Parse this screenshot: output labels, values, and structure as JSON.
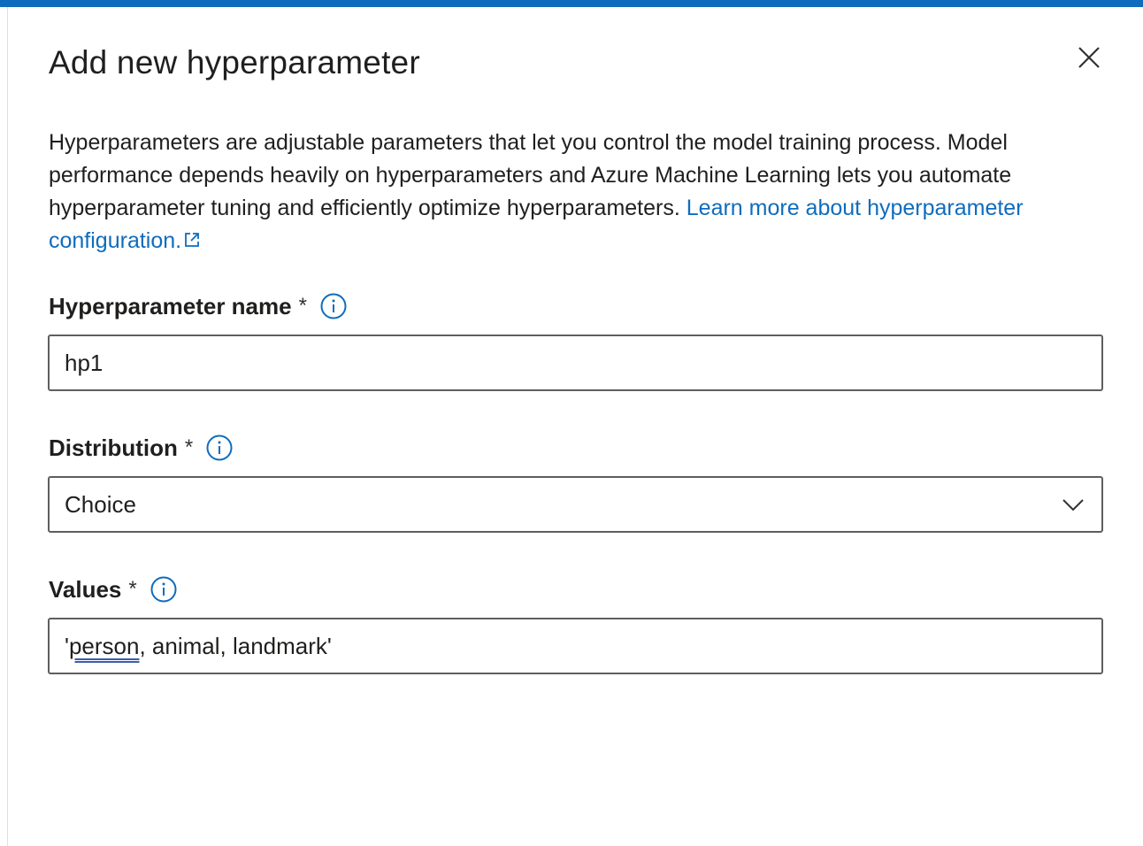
{
  "dialog": {
    "title": "Add new hyperparameter",
    "description": "Hyperparameters are adjustable parameters that let you control the model training process. Model performance depends heavily on hyperparameters and Azure Machine Learning lets you automate hyperparameter tuning and efficiently optimize hyperparameters. ",
    "link_text": "Learn more about hyperparameter configuration.",
    "close_icon": "close-icon",
    "external_link_icon": "external-link-icon"
  },
  "fields": {
    "name": {
      "label": "Hyperparameter name",
      "required_mark": "*",
      "value": "hp1",
      "info_icon": "info-icon"
    },
    "distribution": {
      "label": "Distribution",
      "required_mark": "*",
      "value": "Choice",
      "info_icon": "info-icon",
      "dropdown_icon": "chevron-down-icon"
    },
    "values": {
      "label": "Values",
      "required_mark": "*",
      "value_prefix": "'",
      "value_flagged_word": "person",
      "value_suffix": ", animal, landmark'",
      "info_icon": "info-icon"
    }
  },
  "colors": {
    "accent": "#0f6cbd",
    "text": "#201f1e",
    "border": "#605e5c"
  }
}
